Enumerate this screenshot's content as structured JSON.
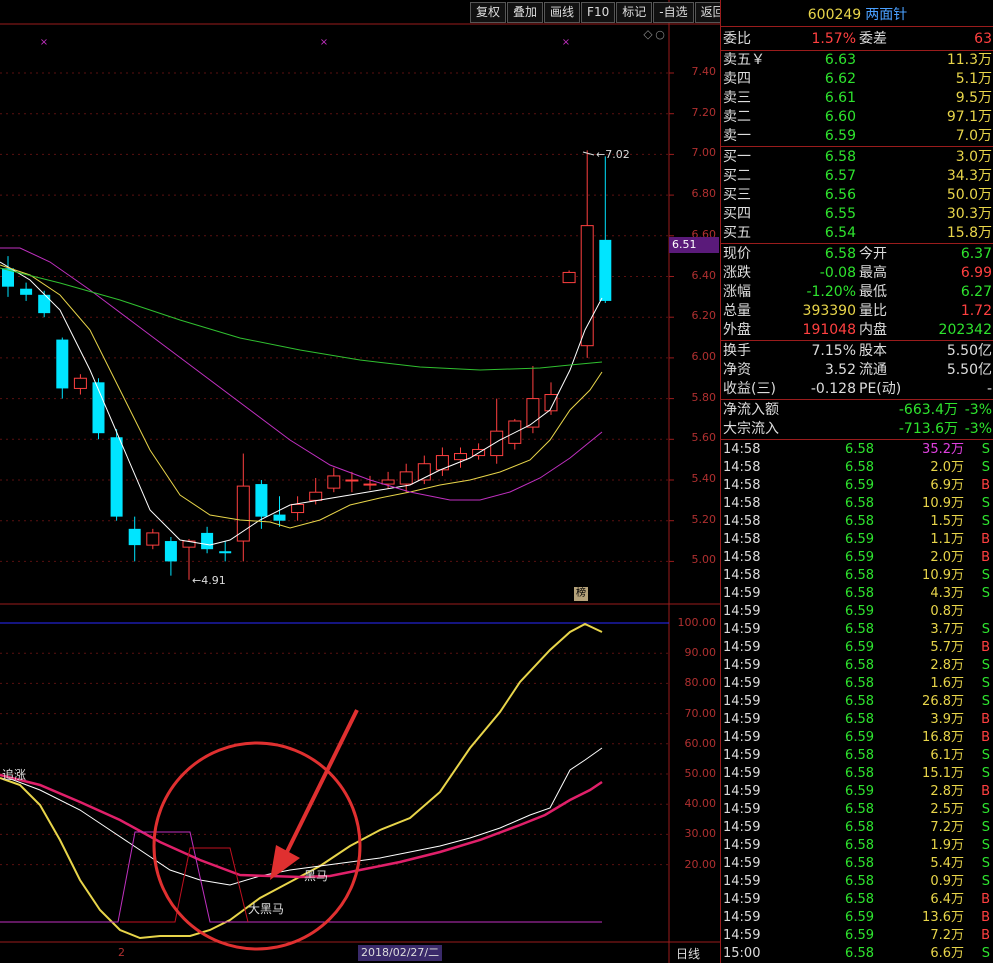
{
  "toolbar": {
    "items": [
      "复权",
      "叠加",
      "画线",
      "F10",
      "标记",
      "-自选",
      "返回"
    ]
  },
  "chart": {
    "price_axis": [
      "7.40",
      "7.20",
      "7.00",
      "6.80",
      "6.60",
      "6.40",
      "6.20",
      "6.00",
      "5.80",
      "5.60",
      "5.40",
      "5.20",
      "5.00"
    ],
    "indicator_axis": [
      "100.00",
      "90.00",
      "80.00",
      "70.00",
      "60.00",
      "50.00",
      "40.00",
      "30.00",
      "20.00"
    ],
    "current_price_tag": "6.51",
    "high_label": "7.02",
    "low_label": "4.91",
    "bang_tag": "榜",
    "date_label": "2018/02/27/二",
    "period_label": "日线",
    "left_marker": "2",
    "indicator_labels": {
      "zhuizhang": "追涨",
      "heima": "黑马",
      "da_heima": "大黑马"
    },
    "colors": {
      "up": "#ff4040",
      "down": "#00e5ff",
      "ma_white": "#ffffff",
      "ma_yellow": "#e8d54a",
      "ma_magenta": "#c030c0",
      "ma_green": "#30c030",
      "circle": "#e03030"
    }
  },
  "chart_data": {
    "type": "candlestick",
    "candles": [
      {
        "o": 6.44,
        "c": 6.35,
        "h": 6.5,
        "l": 6.3
      },
      {
        "o": 6.34,
        "c": 6.31,
        "h": 6.37,
        "l": 6.28
      },
      {
        "o": 6.31,
        "c": 6.22,
        "h": 6.33,
        "l": 6.2
      },
      {
        "o": 6.09,
        "c": 5.85,
        "h": 6.1,
        "l": 5.8
      },
      {
        "o": 5.85,
        "c": 5.9,
        "h": 5.92,
        "l": 5.82
      },
      {
        "o": 5.88,
        "c": 5.63,
        "h": 5.9,
        "l": 5.6
      },
      {
        "o": 5.61,
        "c": 5.22,
        "h": 5.65,
        "l": 5.2
      },
      {
        "o": 5.16,
        "c": 5.08,
        "h": 5.22,
        "l": 5.0
      },
      {
        "o": 5.08,
        "c": 5.14,
        "h": 5.16,
        "l": 5.06
      },
      {
        "o": 5.1,
        "c": 5.0,
        "h": 5.12,
        "l": 4.93
      },
      {
        "o": 5.07,
        "c": 5.1,
        "h": 5.11,
        "l": 4.91
      },
      {
        "o": 5.14,
        "c": 5.06,
        "h": 5.17,
        "l": 5.04
      },
      {
        "o": 5.05,
        "c": 5.04,
        "h": 5.1,
        "l": 5.0
      },
      {
        "o": 5.1,
        "c": 5.37,
        "h": 5.53,
        "l": 5.0
      },
      {
        "o": 5.38,
        "c": 5.22,
        "h": 5.4,
        "l": 5.16
      },
      {
        "o": 5.23,
        "c": 5.2,
        "h": 5.32,
        "l": 5.17
      },
      {
        "o": 5.24,
        "c": 5.28,
        "h": 5.32,
        "l": 5.2
      },
      {
        "o": 5.3,
        "c": 5.34,
        "h": 5.41,
        "l": 5.28
      },
      {
        "o": 5.36,
        "c": 5.42,
        "h": 5.46,
        "l": 5.34
      },
      {
        "o": 5.4,
        "c": 5.4,
        "h": 5.44,
        "l": 5.34
      },
      {
        "o": 5.38,
        "c": 5.38,
        "h": 5.42,
        "l": 5.35
      },
      {
        "o": 5.38,
        "c": 5.4,
        "h": 5.44,
        "l": 5.36
      },
      {
        "o": 5.38,
        "c": 5.44,
        "h": 5.48,
        "l": 5.34
      },
      {
        "o": 5.4,
        "c": 5.48,
        "h": 5.52,
        "l": 5.38
      },
      {
        "o": 5.45,
        "c": 5.52,
        "h": 5.56,
        "l": 5.42
      },
      {
        "o": 5.5,
        "c": 5.53,
        "h": 5.56,
        "l": 5.46
      },
      {
        "o": 5.52,
        "c": 5.55,
        "h": 5.58,
        "l": 5.5
      },
      {
        "o": 5.52,
        "c": 5.64,
        "h": 5.8,
        "l": 5.48
      },
      {
        "o": 5.58,
        "c": 5.69,
        "h": 5.7,
        "l": 5.55
      },
      {
        "o": 5.66,
        "c": 5.8,
        "h": 5.96,
        "l": 5.63
      },
      {
        "o": 5.74,
        "c": 5.82,
        "h": 5.88,
        "l": 5.72
      },
      {
        "o": 6.37,
        "c": 6.42,
        "h": 6.43,
        "l": 6.37
      },
      {
        "o": 6.06,
        "c": 6.65,
        "h": 7.02,
        "l": 6.0
      },
      {
        "o": 6.58,
        "c": 6.28,
        "h": 6.99,
        "l": 6.27
      }
    ],
    "ylim": [
      4.9,
      7.5
    ]
  },
  "side": {
    "code": "600249",
    "name": "两面针",
    "weibi": {
      "label": "委比",
      "value": "1.57%",
      "label2": "委差",
      "value2": "63"
    },
    "sell": [
      {
        "label": "卖五￥",
        "price": "6.63",
        "vol": "11.3万"
      },
      {
        "label": "卖四",
        "price": "6.62",
        "vol": "5.1万"
      },
      {
        "label": "卖三",
        "price": "6.61",
        "vol": "9.5万"
      },
      {
        "label": "卖二",
        "price": "6.60",
        "vol": "97.1万"
      },
      {
        "label": "卖一",
        "price": "6.59",
        "vol": "7.0万"
      }
    ],
    "buy": [
      {
        "label": "买一",
        "price": "6.58",
        "vol": "3.0万"
      },
      {
        "label": "买二",
        "price": "6.57",
        "vol": "34.3万"
      },
      {
        "label": "买三",
        "price": "6.56",
        "vol": "50.0万"
      },
      {
        "label": "买四",
        "price": "6.55",
        "vol": "30.3万"
      },
      {
        "label": "买五",
        "price": "6.54",
        "vol": "15.8万"
      }
    ],
    "quote": [
      {
        "l1": "现价",
        "v1": "6.58",
        "c1": "green",
        "l2": "今开",
        "v2": "6.37",
        "c2": "green"
      },
      {
        "l1": "涨跌",
        "v1": "-0.08",
        "c1": "green",
        "l2": "最高",
        "v2": "6.99",
        "c2": "red"
      },
      {
        "l1": "涨幅",
        "v1": "-1.20%",
        "c1": "green",
        "l2": "最低",
        "v2": "6.27",
        "c2": "green"
      },
      {
        "l1": "总量",
        "v1": "393390",
        "c1": "yellow",
        "l2": "量比",
        "v2": "1.72",
        "c2": "red"
      },
      {
        "l1": "外盘",
        "v1": "191048",
        "c1": "red",
        "l2": "内盘",
        "v2": "202342",
        "c2": "green"
      }
    ],
    "fundamentals": [
      {
        "l1": "换手",
        "v1": "7.15%",
        "c1": "white",
        "l2": "股本",
        "v2": "5.50亿",
        "c2": "white"
      },
      {
        "l1": "净资",
        "v1": "3.52",
        "c1": "white",
        "l2": "流通",
        "v2": "5.50亿",
        "c2": "white"
      },
      {
        "l1": "收益(三)",
        "v1": "-0.128",
        "c1": "white",
        "l2": "PE(动)",
        "v2": "-",
        "c2": "white"
      }
    ],
    "flows": [
      {
        "label": "净流入额",
        "value": "-663.4万",
        "pct": "-3%"
      },
      {
        "label": "大宗流入",
        "value": "-713.6万",
        "pct": "-3%"
      }
    ],
    "ticks": [
      {
        "time": "14:58",
        "price": "6.58",
        "vol": "35.2万",
        "dir": "S",
        "vc": "magenta"
      },
      {
        "time": "14:58",
        "price": "6.58",
        "vol": "2.0万",
        "dir": "S",
        "vc": "yellow"
      },
      {
        "time": "14:58",
        "price": "6.59",
        "vol": "6.9万",
        "dir": "B",
        "vc": "yellow"
      },
      {
        "time": "14:58",
        "price": "6.58",
        "vol": "10.9万",
        "dir": "S",
        "vc": "yellow"
      },
      {
        "time": "14:58",
        "price": "6.58",
        "vol": "1.5万",
        "dir": "S",
        "vc": "yellow"
      },
      {
        "time": "14:58",
        "price": "6.59",
        "vol": "1.1万",
        "dir": "B",
        "vc": "yellow"
      },
      {
        "time": "14:58",
        "price": "6.59",
        "vol": "2.0万",
        "dir": "B",
        "vc": "yellow"
      },
      {
        "time": "14:58",
        "price": "6.58",
        "vol": "10.9万",
        "dir": "S",
        "vc": "yellow"
      },
      {
        "time": "14:59",
        "price": "6.58",
        "vol": "4.3万",
        "dir": "S",
        "vc": "yellow"
      },
      {
        "time": "14:59",
        "price": "6.59",
        "vol": "0.8万",
        "dir": "",
        "vc": "yellow"
      },
      {
        "time": "14:59",
        "price": "6.58",
        "vol": "3.7万",
        "dir": "S",
        "vc": "yellow"
      },
      {
        "time": "14:59",
        "price": "6.59",
        "vol": "5.7万",
        "dir": "B",
        "vc": "yellow"
      },
      {
        "time": "14:59",
        "price": "6.58",
        "vol": "2.8万",
        "dir": "S",
        "vc": "yellow"
      },
      {
        "time": "14:59",
        "price": "6.58",
        "vol": "1.6万",
        "dir": "S",
        "vc": "yellow"
      },
      {
        "time": "14:59",
        "price": "6.58",
        "vol": "26.8万",
        "dir": "S",
        "vc": "yellow"
      },
      {
        "time": "14:59",
        "price": "6.58",
        "vol": "3.9万",
        "dir": "B",
        "vc": "yellow"
      },
      {
        "time": "14:59",
        "price": "6.59",
        "vol": "16.8万",
        "dir": "B",
        "vc": "yellow"
      },
      {
        "time": "14:59",
        "price": "6.58",
        "vol": "6.1万",
        "dir": "S",
        "vc": "yellow"
      },
      {
        "time": "14:59",
        "price": "6.58",
        "vol": "15.1万",
        "dir": "S",
        "vc": "yellow"
      },
      {
        "time": "14:59",
        "price": "6.59",
        "vol": "2.8万",
        "dir": "B",
        "vc": "yellow"
      },
      {
        "time": "14:59",
        "price": "6.58",
        "vol": "2.5万",
        "dir": "S",
        "vc": "yellow"
      },
      {
        "time": "14:59",
        "price": "6.58",
        "vol": "7.2万",
        "dir": "S",
        "vc": "yellow"
      },
      {
        "time": "14:59",
        "price": "6.58",
        "vol": "1.9万",
        "dir": "S",
        "vc": "yellow"
      },
      {
        "time": "14:59",
        "price": "6.58",
        "vol": "5.4万",
        "dir": "S",
        "vc": "yellow"
      },
      {
        "time": "14:59",
        "price": "6.58",
        "vol": "0.9万",
        "dir": "S",
        "vc": "yellow"
      },
      {
        "time": "14:59",
        "price": "6.58",
        "vol": "6.4万",
        "dir": "B",
        "vc": "yellow"
      },
      {
        "time": "14:59",
        "price": "6.59",
        "vol": "13.6万",
        "dir": "B",
        "vc": "yellow"
      },
      {
        "time": "14:59",
        "price": "6.59",
        "vol": "7.2万",
        "dir": "B",
        "vc": "yellow"
      },
      {
        "time": "15:00",
        "price": "6.58",
        "vol": "6.6万",
        "dir": "S",
        "vc": "yellow"
      }
    ]
  }
}
